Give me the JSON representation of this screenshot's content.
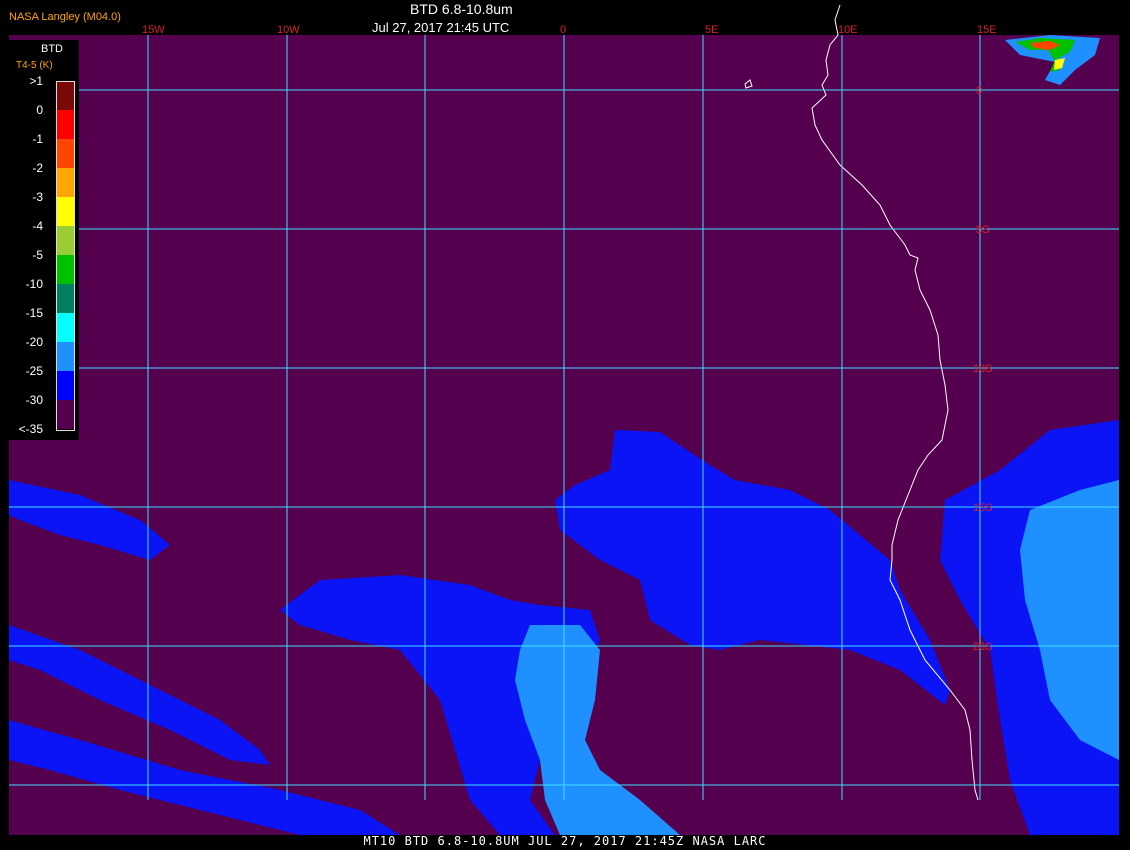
{
  "header": {
    "organization": "NASA Langley (M04.0)",
    "title": "BTD 6.8-10.8um",
    "subtitle": "Jul 27, 2017 21:45 UTC"
  },
  "footer": "MT10  BTD 6.8-10.8UM  JUL 27, 2017 21:45Z  NASA LARC",
  "longitude_labels": [
    "15W",
    "10W",
    "0",
    "5E",
    "10E",
    "15E"
  ],
  "latitude_labels": [
    "0",
    "5S",
    "10S",
    "15S",
    "20S"
  ],
  "legend": {
    "title": "BTD",
    "units": "T4-5 (K)",
    "entries": [
      {
        "label": ">1",
        "color": "#7a0a0a"
      },
      {
        "label": "0",
        "color": "#ff0000"
      },
      {
        "label": "-1",
        "color": "#ff4500"
      },
      {
        "label": "-2",
        "color": "#ffa500"
      },
      {
        "label": "-3",
        "color": "#ffff00"
      },
      {
        "label": "-4",
        "color": "#9acd32"
      },
      {
        "label": "-5",
        "color": "#00c000"
      },
      {
        "label": "-10",
        "color": "#008060"
      },
      {
        "label": "-15",
        "color": "#00ffff"
      },
      {
        "label": "-20",
        "color": "#1e90ff"
      },
      {
        "label": "-25",
        "color": "#0000ff"
      },
      {
        "label": "-30",
        "color": "#55004f"
      },
      {
        "label": "<-35",
        "color": ""
      }
    ]
  },
  "colors": {
    "background": "#55004f",
    "grid": "#3ce0ff",
    "coastline": "#ffffff",
    "cloud_blue": "#0a14f5",
    "cloud_light": "#1e90ff"
  }
}
